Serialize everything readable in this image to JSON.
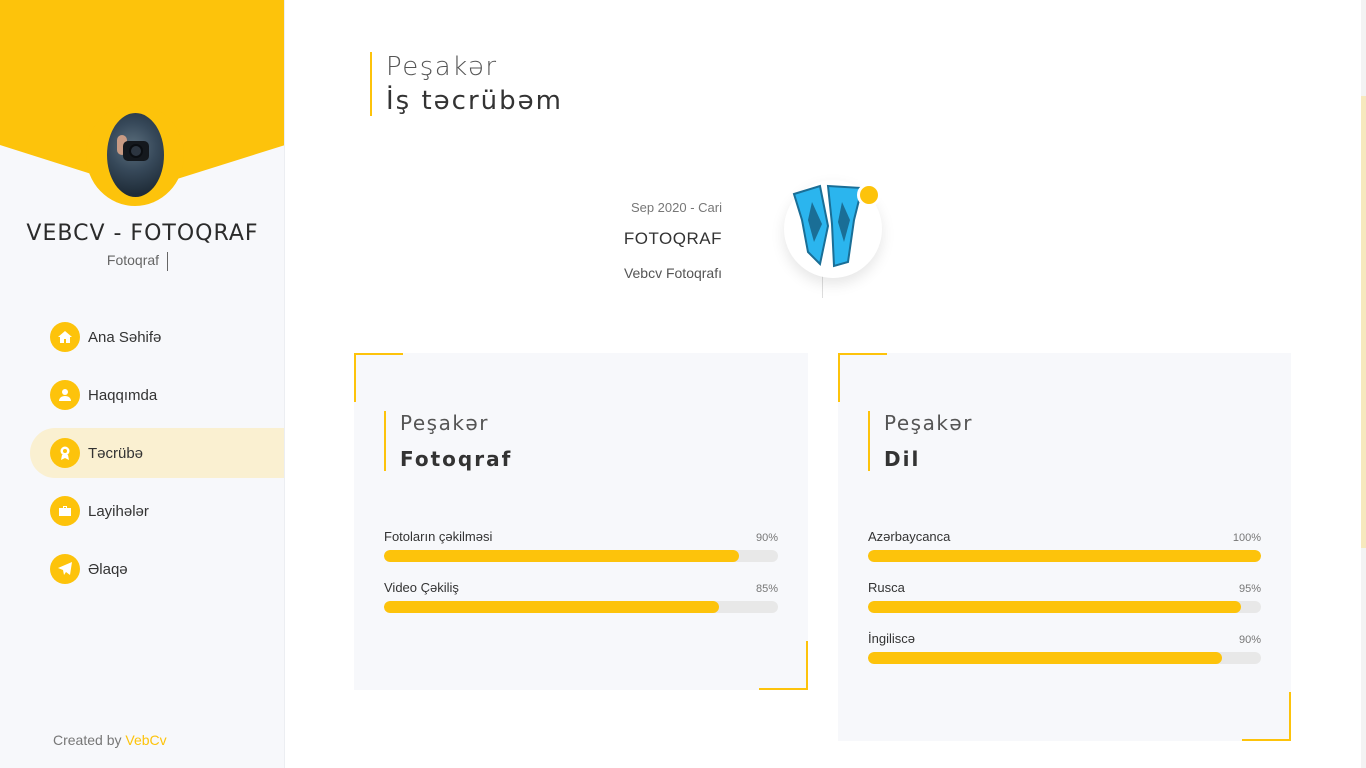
{
  "sidebar": {
    "title": "VEBCV - FOTOQRAF",
    "subtitle": "Fotoqraf",
    "nav": [
      {
        "label": "Ana Səhifə",
        "icon": "home-icon"
      },
      {
        "label": "Haqqımda",
        "icon": "user-icon"
      },
      {
        "label": "Təcrübə",
        "icon": "award-icon",
        "active": true
      },
      {
        "label": "Layihələr",
        "icon": "briefcase-icon"
      },
      {
        "label": "Əlaqə",
        "icon": "paper-plane-icon"
      }
    ],
    "footer": {
      "prefix": "Created by ",
      "brand": "VebCv"
    }
  },
  "section": {
    "top": "Peşakər",
    "main": "İş təcrübəm"
  },
  "timeline": {
    "date": "Sep 2020 - Cari",
    "role": "FOTOQRAF",
    "company": "Vebcv Fotoqrafı"
  },
  "cards": [
    {
      "top": "Peşakər",
      "main": "Fotoqraf",
      "skills": [
        {
          "name": "Fotoların çəkilməsi",
          "percent_label": "90%",
          "percent": 90
        },
        {
          "name": "Video Çəkiliş",
          "percent_label": "85%",
          "percent": 85
        }
      ]
    },
    {
      "top": "Peşakər",
      "main": "Dil",
      "skills": [
        {
          "name": "Azərbaycanca",
          "percent_label": "100%",
          "percent": 100
        },
        {
          "name": "Rusca",
          "percent_label": "95%",
          "percent": 95
        },
        {
          "name": "İngiliscə",
          "percent_label": "90%",
          "percent": 90
        }
      ]
    }
  ],
  "colors": {
    "accent": "#fdc30b",
    "sidebar_bg": "#f7f8fb",
    "active_nav_bg": "#faf0d1",
    "logo_blue": "#2bb5ee"
  }
}
